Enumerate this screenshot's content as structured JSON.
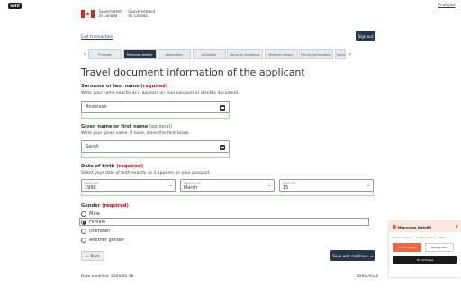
{
  "browser": {
    "extension_badge": "notif"
  },
  "header": {
    "wordmark_en_1": "Government",
    "wordmark_en_2": "of Canada",
    "wordmark_fr_1": "Gouvernement",
    "wordmark_fr_2": "du Canada",
    "language_toggle": "Français"
  },
  "actions": {
    "exit_label": "Exit transaction",
    "signout_label": "Sign out"
  },
  "progress": {
    "prev_arrow": "‹",
    "next_arrow": "›",
    "tabs": [
      {
        "label": "Purpose",
        "active": false
      },
      {
        "label": "Personal details",
        "active": true
      },
      {
        "label": "Application",
        "active": false
      },
      {
        "label": "Activities",
        "active": false
      },
      {
        "label": "Security questions",
        "active": false
      },
      {
        "label": "Medical history",
        "active": false
      },
      {
        "label": "Family information",
        "active": false
      },
      {
        "label": "Conta",
        "active": false
      }
    ]
  },
  "form": {
    "title": "Travel document information of the applicant",
    "required_tag": "(required)",
    "optional_tag": "(optional)",
    "surname": {
      "label": "Surname or last name",
      "hint": "Write your name exactly as it appears on your passport or identity document.",
      "value": "Anderson"
    },
    "given_name": {
      "label": "Given name or first name",
      "hint": "Write your given name. If none, leave this field blank.",
      "value": "Sarah"
    },
    "dob": {
      "label": "Date of birth",
      "hint": "Select your date of birth exactly as it appears on your passport.",
      "year_mini": "Select year",
      "year_value": "1990",
      "month_mini": "Select month",
      "month_value": "March",
      "day_mini": "Select day",
      "day_value": "15"
    },
    "gender": {
      "label": "Gender",
      "options": [
        "Male",
        "Female",
        "Unknown",
        "Another gender"
      ],
      "selected": "Female"
    }
  },
  "footer": {
    "back_label": "Back",
    "save_label": "Save and continue",
    "date_modified": "Date modified: 2026-02-18",
    "build_id": "3284c9542"
  },
  "assistant": {
    "title": "Migravisa Autofill",
    "close_glyph": "×",
    "subtitle": "Sarah Anderson — Sarah Anderson · Welco...",
    "fill_label": "Fill This Page",
    "savenext_label": "Save & Next",
    "fillall_label": "Fill All Pages"
  }
}
